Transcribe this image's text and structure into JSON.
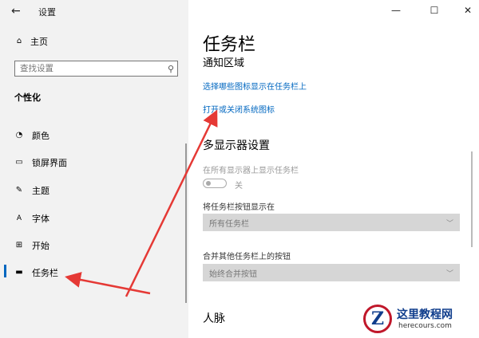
{
  "window": {
    "title": "设置",
    "back_icon": "back-arrow-icon",
    "minimize": "—",
    "maximize": "☐",
    "close": "✕"
  },
  "sidebar": {
    "home_label": "主页",
    "search_placeholder": "查找设置",
    "section_title": "个性化",
    "items": [
      {
        "label": "颜色",
        "icon": "palette-icon"
      },
      {
        "label": "锁屏界面",
        "icon": "lock-screen-icon"
      },
      {
        "label": "主题",
        "icon": "theme-icon"
      },
      {
        "label": "字体",
        "icon": "font-icon"
      },
      {
        "label": "开始",
        "icon": "start-icon"
      },
      {
        "label": "任务栏",
        "icon": "taskbar-icon"
      }
    ],
    "active_item": "任务栏"
  },
  "main": {
    "title": "任务栏",
    "notification_area_title": "通知区域",
    "link_select_icons": "选择哪些图标显示在任务栏上",
    "link_system_icons": "打开或关闭系统图标",
    "multi_display_title": "多显示器设置",
    "show_all_displays_label": "在所有显示器上显示任务栏",
    "toggle_state": "关",
    "show_buttons_label": "将任务栏按钮显示在",
    "show_buttons_value": "所有任务栏",
    "combine_label": "合并其他任务栏上的按钮",
    "combine_value": "始终合并按钮",
    "people_title": "人脉"
  },
  "watermark": {
    "logo_letter": "Z",
    "name": "这里教程网",
    "domain": "herecours.com"
  },
  "colors": {
    "accent": "#0067c0",
    "arrow": "#e53935",
    "sidebar_bg": "#f2f2f2"
  }
}
